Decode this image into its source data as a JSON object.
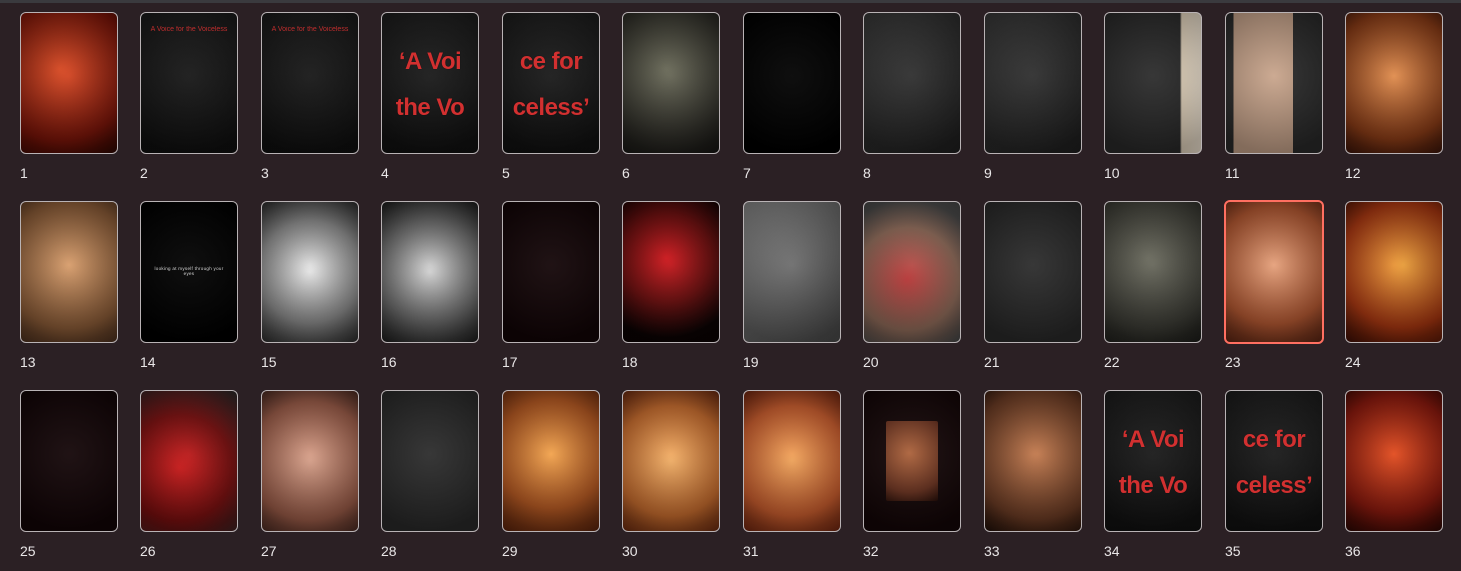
{
  "slides": [
    {
      "num": "1",
      "bg": "radial-gradient(circle at 40% 40%, #e04a22, #7a1206 70%, #2a0702)"
    },
    {
      "num": "2",
      "bg": "linear-gradient(#1a1a1a,#101010)",
      "text": "A Voice for the Voiceless"
    },
    {
      "num": "3",
      "bg": "linear-gradient(#1a1a1a,#101010)",
      "text": "A Voice for the Voiceless"
    },
    {
      "num": "4",
      "bg": "linear-gradient(#1d1d1d,#111)",
      "text": "‘A Voi the Vo"
    },
    {
      "num": "5",
      "bg": "linear-gradient(#1d1d1d,#111)",
      "text": "ce for celess’"
    },
    {
      "num": "6",
      "bg": "radial-gradient(circle at 45% 40%, #6a6a58, #2c2b25 70%, #151412)"
    },
    {
      "num": "7",
      "bg": "#000"
    },
    {
      "num": "8",
      "bg": "linear-gradient(135deg,#3a3a3a,#1f1f1f)"
    },
    {
      "num": "9",
      "bg": "linear-gradient(135deg,#3a3a3a,#1f1f1f)"
    },
    {
      "num": "10",
      "bg": "linear-gradient(90deg,#2b2b2b 78%, #e8d8c0 80%, #f3e7d5)"
    },
    {
      "num": "11",
      "bg": "linear-gradient(90deg,#2b2b2b 0 8%, #c9a58c 8% 70%, #2b2b2b 70%)"
    },
    {
      "num": "12",
      "bg": "radial-gradient(circle at 50% 45%, #e08b4b, #8a3a14 70%, #3a140a)"
    },
    {
      "num": "13",
      "bg": "radial-gradient(circle at 50% 45%, #d79c6a, #8a5a35 70%, #4a2f1e)"
    },
    {
      "num": "14",
      "bg": "#000",
      "text": "looking at myself through your eyes"
    },
    {
      "num": "15",
      "bg": "radial-gradient(circle at 50% 50%, #eaeaea, #8a8a8a 60%, #2a2a2a)"
    },
    {
      "num": "16",
      "bg": "radial-gradient(circle at 50% 50%, #d6d6d6, #6a6a6a 60%, #1a1a1a)"
    },
    {
      "num": "17",
      "bg": "#120406"
    },
    {
      "num": "18",
      "bg": "radial-gradient(circle at 45% 40%, #d1151a, #6b0b0b 45%, #0b0202 80%)"
    },
    {
      "num": "19",
      "bg": "linear-gradient(135deg,#8a8a8a,#4a4a4a)"
    },
    {
      "num": "20",
      "bg": "radial-gradient(circle at 45% 55%, #c23a3a, #8f6a58 55%, #4a4a4a 85%)"
    },
    {
      "num": "21",
      "bg": "#2b2b2b"
    },
    {
      "num": "22",
      "bg": "radial-gradient(circle at 45% 40%, #6b6b5e, #3a3a33 70%, #1c1c19)"
    },
    {
      "num": "23",
      "bg": "radial-gradient(circle at 50% 45%, #e5a07a, #b3562f 65%, #5a2413)",
      "selected": true
    },
    {
      "num": "24",
      "bg": "radial-gradient(circle at 60% 45%, #f1a23a, #a9350e 65%, #3a0d05)"
    },
    {
      "num": "25",
      "bg": "#120406"
    },
    {
      "num": "26",
      "bg": "radial-gradient(circle at 40% 55%, #d31a1a, #7b0d0d 55%, #2a2a2a)"
    },
    {
      "num": "27",
      "bg": "radial-gradient(circle at 50% 50%, #d9a18a, #9a5a46 70%, #4a2a22)"
    },
    {
      "num": "28",
      "bg": "#2b2b2b"
    },
    {
      "num": "29",
      "bg": "radial-gradient(circle at 50% 45%, #f2a24b, #b5571f 60%, #5a220c)"
    },
    {
      "num": "30",
      "bg": "radial-gradient(circle at 50% 50%, #f4b066, #c66a2b 65%, #6b2a10)"
    },
    {
      "num": "31",
      "bg": "radial-gradient(circle at 50% 50%, #f3a55a, #c95b2b 65%, #6f2510)"
    },
    {
      "num": "32",
      "bg": "linear-gradient(#140607,#140607)"
    },
    {
      "num": "33",
      "bg": "radial-gradient(circle at 55% 45%, #c47a4d, #6b3a22 70%, #1e0f09)"
    },
    {
      "num": "34",
      "bg": "linear-gradient(#1d1d1d,#111)",
      "text": "‘A Voi the Vo"
    },
    {
      "num": "35",
      "bg": "linear-gradient(#1d1d1d,#111)",
      "text": "ce for celess’"
    },
    {
      "num": "36",
      "bg": "radial-gradient(circle at 50% 45%, #e24a1c, #8b160a 65%, #2a0704)"
    }
  ]
}
